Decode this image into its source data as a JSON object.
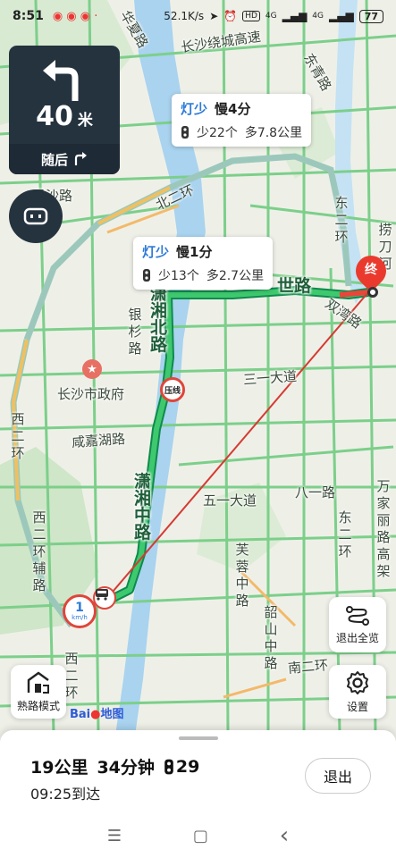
{
  "status_bar": {
    "time": "8:51",
    "net_speed": "52.1K/s",
    "signal1": "4G",
    "signal2": "4G",
    "battery": "77"
  },
  "turn_panel": {
    "distance": "40",
    "unit": "米",
    "then_label": "随后",
    "icons": [
      "turn-left-icon",
      "turn-right-icon"
    ]
  },
  "route_bubbles": [
    {
      "tag": "灯少",
      "time": "慢4分",
      "lights": "少22个",
      "distance": "多7.8公里"
    },
    {
      "tag": "灯少",
      "time": "慢1分",
      "lights": "少13个",
      "distance": "多2.7公里"
    }
  ],
  "map_labels": {
    "ring_highway": "长沙绕城高速",
    "north_ring": "北二环",
    "east_ring": "东二环",
    "gov": "长沙市政府",
    "xianjia": "咸嘉湖路",
    "yinshan": "银杉路",
    "xiaoxiang_north": "潇湘北路",
    "xiaoxiang_mid": "潇湘中路",
    "west_ring": "西二环",
    "west_ring_aux": "西二环辅路",
    "shiji": "世路",
    "shuangyong": "双湾路",
    "sanyi": "三一大道",
    "wuyi": "五一大道",
    "bayi": "八一路",
    "furong": "芙蓉中路",
    "shaoshan": "韶山中路",
    "south_ring": "南二环",
    "wanjiali": "万家丽路高架",
    "east2": "东二环",
    "dongqing": "东青路",
    "huaxia": "华夏路",
    "xi_two": "西二环",
    "laodao": "捞刀河",
    "xingsha": "星沙路",
    "end_marker": "终",
    "speed": "1",
    "speed_unit": "km/h",
    "pass_marker": "压线"
  },
  "side_buttons": {
    "exit_overview": "退出全览",
    "settings": "设置",
    "familiar_mode": "熟路模式"
  },
  "baidu_logo": {
    "part1": "Bai",
    "part2": "地图"
  },
  "bottom_panel": {
    "distance": "19公里",
    "duration": "34分钟",
    "lights": "29",
    "arrival": "09:25到达",
    "exit_label": "退出"
  },
  "navbar": {
    "menu": "☰",
    "home": "▢",
    "back": "‹"
  }
}
